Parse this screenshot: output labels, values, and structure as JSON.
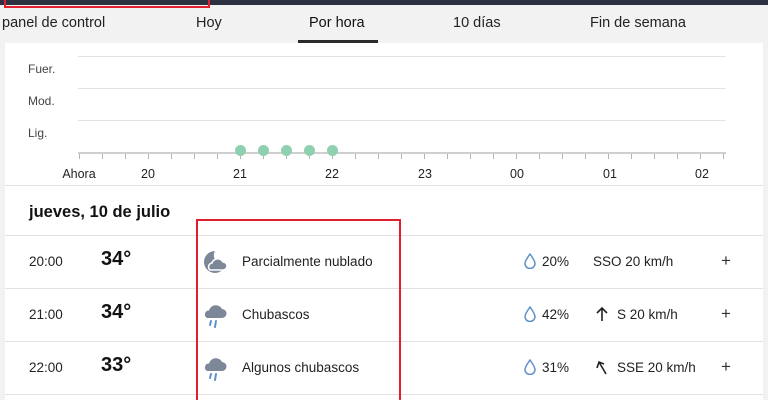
{
  "tabs": [
    {
      "label": "panel de control"
    },
    {
      "label": "Hoy"
    },
    {
      "label": "Por hora"
    },
    {
      "label": "10 días"
    },
    {
      "label": "Fin de semana"
    }
  ],
  "active_tab": "Por hora",
  "chart": {
    "y_labels": [
      "Fuer.",
      "Mod.",
      "Lig."
    ],
    "x_labels": [
      "Ahora",
      "20",
      "21",
      "22",
      "23",
      "00",
      "01",
      "02"
    ]
  },
  "chart_data": {
    "type": "scatter",
    "y_categories": [
      "Lig.",
      "Mod.",
      "Fuer."
    ],
    "x_tick_labels": [
      "Ahora",
      "20",
      "21",
      "22",
      "23",
      "00",
      "01",
      "02"
    ],
    "points": [
      {
        "time": "21:00",
        "intensity": "Lig."
      },
      {
        "time": "21:15",
        "intensity": "Lig."
      },
      {
        "time": "21:30",
        "intensity": "Lig."
      },
      {
        "time": "21:45",
        "intensity": "Lig."
      },
      {
        "time": "22:00",
        "intensity": "Lig."
      }
    ],
    "color": "#8fd0b0"
  },
  "date_header": "jueves, 10 de julio",
  "rows": [
    {
      "hour": "20:00",
      "temp": "34°",
      "icon": "partly-cloudy-night-icon",
      "condition": "Parcialmente nublado",
      "precip": "20%",
      "wind": "SSO 20 km/h",
      "wind_arrow": "none"
    },
    {
      "hour": "21:00",
      "temp": "34°",
      "icon": "showers-icon",
      "condition": "Chubascos",
      "precip": "42%",
      "wind": "S 20 km/h",
      "wind_arrow": "arrow-up-icon"
    },
    {
      "hour": "22:00",
      "temp": "33°",
      "icon": "showers-icon",
      "condition": "Algunos chubascos",
      "precip": "31%",
      "wind": "SSE 20 km/h",
      "wind_arrow": "arrow-up-left-icon"
    }
  ],
  "expand_label": "+",
  "colors": {
    "accent": "#2b2b2b",
    "precip_dot": "#8fd0b0",
    "highlight_box": "#e0202f",
    "drop": "#5e8fc9"
  }
}
